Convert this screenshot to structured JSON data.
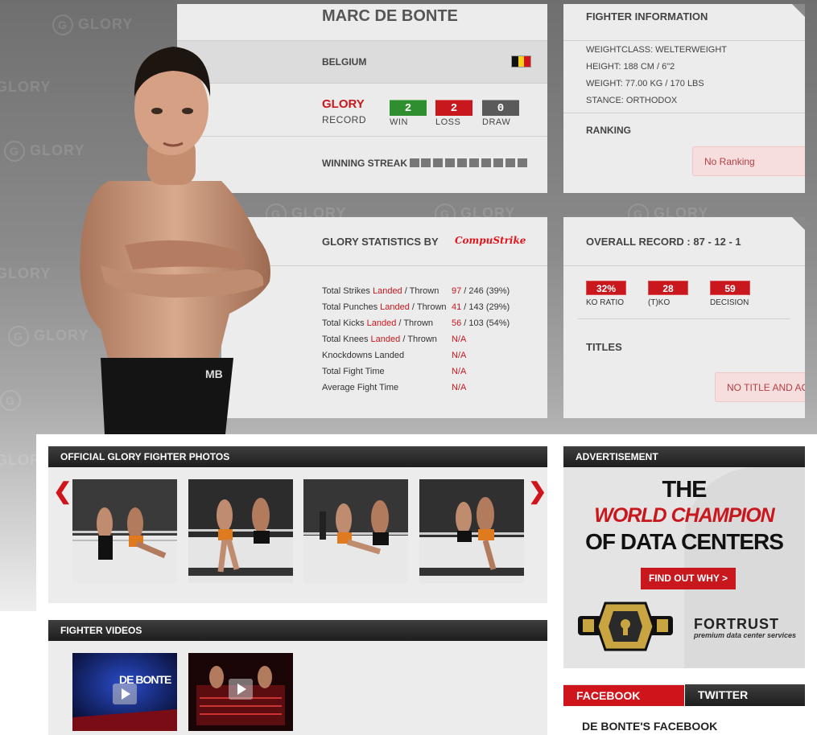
{
  "fighter": {
    "name": "MARC DE BONTE",
    "country": "BELGIUM",
    "record_brand": "GLORY",
    "record_label": "RECORD",
    "win_value": "2",
    "win_label": "WIN",
    "loss_value": "2",
    "loss_label": "LOSS",
    "draw_value": "0",
    "draw_label": "DRAW",
    "streak_label": "WINNING STREAK"
  },
  "info": {
    "title": "FIGHTER INFORMATION",
    "weightclass": "WEIGHTCLASS: WELTERWEIGHT",
    "height": "HEIGHT: 188 CM / 6\"2",
    "weight": "WEIGHT: 77.00 KG / 170 LBS",
    "stance": "STANCE: ORTHODOX",
    "ranking_title": "RANKING",
    "ranking_value": "No Ranking"
  },
  "stats": {
    "title": "GLORY STATISTICS BY",
    "sponsor": "CompuStrike",
    "rows": [
      {
        "pre": "Total Strikes ",
        "landed": "Landed",
        "post": " / Thrown",
        "val_a": "97",
        "val_b": " / 246 (39%)"
      },
      {
        "pre": "Total Punches ",
        "landed": "Landed",
        "post": " / Thrown",
        "val_a": "41",
        "val_b": " / 143 (29%)"
      },
      {
        "pre": "Total Kicks ",
        "landed": "Landed",
        "post": " / Thrown",
        "val_a": "56",
        "val_b": " / 103 (54%)"
      },
      {
        "pre": "Total Knees ",
        "landed": "Landed",
        "post": " / Thrown",
        "val_a": "N/A",
        "val_b": ""
      },
      {
        "pre": "Knockdowns Landed",
        "landed": "",
        "post": "",
        "val_a": "N/A",
        "val_b": ""
      },
      {
        "pre": "Total Fight Time",
        "landed": "",
        "post": "",
        "val_a": "N/A",
        "val_b": ""
      },
      {
        "pre": "Average Fight Time",
        "landed": "",
        "post": "",
        "val_a": "N/A",
        "val_b": ""
      }
    ]
  },
  "overall": {
    "title": "OVERALL RECORD : 87 - 12 - 1",
    "ko_ratio_value": "32%",
    "ko_ratio_label": "KO RATIO",
    "tko_value": "28",
    "tko_label": "(T)KO",
    "decision_value": "59",
    "decision_label": "DECISION",
    "titles_title": "TITLES",
    "titles_value": "NO TITLE AND ACHIEVEMENTS"
  },
  "photos": {
    "title": "OFFICIAL GLORY FIGHTER PHOTOS"
  },
  "videos": {
    "title": "FIGHTER VIDEOS",
    "video1_text": "DE BONTE"
  },
  "ad": {
    "title": "ADVERTISEMENT",
    "line1": "THE",
    "line2": "WORLD CHAMPION",
    "line3": "OF DATA CENTERS",
    "cta": "FIND OUT WHY >",
    "brand": "FORTRUST",
    "brand_sub": "premium data center services"
  },
  "social": {
    "tab_facebook": "FACEBOOK",
    "tab_twitter": "TWITTER",
    "feed_title": "DE BONTE'S FACEBOOK"
  },
  "watermark": {
    "text": "GLORY"
  },
  "colors": {
    "accent": "#c8171d",
    "win": "#2f8f2f",
    "loss": "#c8171d",
    "draw": "#5a5a5a"
  }
}
